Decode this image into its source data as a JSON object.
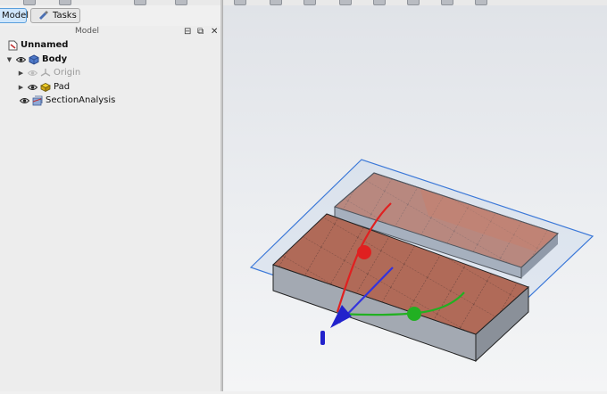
{
  "tabs": [
    {
      "label": "Model",
      "active": true
    },
    {
      "label": "Tasks",
      "active": false
    }
  ],
  "panel": {
    "title": "Model",
    "buttons": [
      "⊟",
      "⧉",
      "✕"
    ]
  },
  "tree": [
    {
      "label": "Unnamed",
      "bold": true,
      "icon": "document-icon",
      "depth": 0
    },
    {
      "label": "Body",
      "bold": true,
      "icon": "body-icon",
      "depth": 1,
      "expanded": true
    },
    {
      "label": "Origin",
      "bold": false,
      "icon": "origin-icon",
      "depth": 2,
      "hidden": true
    },
    {
      "label": "Pad",
      "bold": false,
      "icon": "pad-icon",
      "depth": 2
    },
    {
      "label": "SectionAnalysis",
      "bold": false,
      "icon": "section-analysis-icon",
      "depth": 1
    }
  ],
  "colors": {
    "selection_tab": "#cfe6fb",
    "pad_top_face": "#b06a58",
    "pad_side_face": "#9aa0aa",
    "section_plane_edge": "#3b78d8",
    "axis_x": "#e02020",
    "axis_y": "#22b022",
    "axis_z": "#2222cc"
  }
}
